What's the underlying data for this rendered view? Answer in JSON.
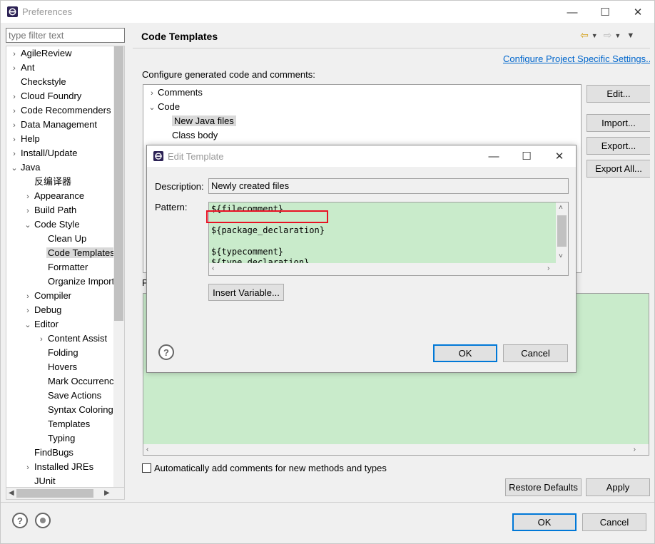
{
  "window": {
    "title": "Preferences",
    "controls": {
      "minimize": "—",
      "maximize": "☐",
      "close": "✕"
    }
  },
  "filter": {
    "placeholder": "type filter text"
  },
  "tree": [
    {
      "label": "AgileReview",
      "level": 0,
      "expand": "collapsed"
    },
    {
      "label": "Ant",
      "level": 0,
      "expand": "collapsed"
    },
    {
      "label": "Checkstyle",
      "level": 0,
      "expand": "none"
    },
    {
      "label": "Cloud Foundry",
      "level": 0,
      "expand": "collapsed"
    },
    {
      "label": "Code Recommenders",
      "level": 0,
      "expand": "collapsed"
    },
    {
      "label": "Data Management",
      "level": 0,
      "expand": "collapsed"
    },
    {
      "label": "Help",
      "level": 0,
      "expand": "collapsed"
    },
    {
      "label": "Install/Update",
      "level": 0,
      "expand": "collapsed"
    },
    {
      "label": "Java",
      "level": 0,
      "expand": "expanded"
    },
    {
      "label": "反编译器",
      "level": 1,
      "expand": "none"
    },
    {
      "label": "Appearance",
      "level": 1,
      "expand": "collapsed"
    },
    {
      "label": "Build Path",
      "level": 1,
      "expand": "collapsed"
    },
    {
      "label": "Code Style",
      "level": 1,
      "expand": "expanded"
    },
    {
      "label": "Clean Up",
      "level": 2,
      "expand": "none"
    },
    {
      "label": "Code Templates",
      "level": 2,
      "expand": "none",
      "selected": true
    },
    {
      "label": "Formatter",
      "level": 2,
      "expand": "none"
    },
    {
      "label": "Organize Imports",
      "level": 2,
      "expand": "none"
    },
    {
      "label": "Compiler",
      "level": 1,
      "expand": "collapsed"
    },
    {
      "label": "Debug",
      "level": 1,
      "expand": "collapsed"
    },
    {
      "label": "Editor",
      "level": 1,
      "expand": "expanded"
    },
    {
      "label": "Content Assist",
      "level": 2,
      "expand": "collapsed"
    },
    {
      "label": "Folding",
      "level": 2,
      "expand": "none"
    },
    {
      "label": "Hovers",
      "level": 2,
      "expand": "none"
    },
    {
      "label": "Mark Occurrences",
      "level": 2,
      "expand": "none"
    },
    {
      "label": "Save Actions",
      "level": 2,
      "expand": "none"
    },
    {
      "label": "Syntax Coloring",
      "level": 2,
      "expand": "none"
    },
    {
      "label": "Templates",
      "level": 2,
      "expand": "none"
    },
    {
      "label": "Typing",
      "level": 2,
      "expand": "none"
    },
    {
      "label": "FindBugs",
      "level": 1,
      "expand": "none"
    },
    {
      "label": "Installed JREs",
      "level": 1,
      "expand": "collapsed"
    },
    {
      "label": "JUnit",
      "level": 1,
      "expand": "none"
    }
  ],
  "page": {
    "title": "Code Templates",
    "configure_link": "Configure Project Specific Settings...",
    "configure_label": "Configure generated code and comments:",
    "pattern_label": "P",
    "auto_comments_label": "Automatically add comments for new methods and types",
    "template_tree": [
      {
        "label": "Comments",
        "level": 0,
        "expand": "collapsed"
      },
      {
        "label": "Code",
        "level": 0,
        "expand": "expanded"
      },
      {
        "label": "New Java files",
        "level": 1,
        "expand": "none",
        "selected": true
      },
      {
        "label": "Class body",
        "level": 1,
        "expand": "none"
      }
    ],
    "buttons": {
      "edit": "Edit...",
      "import": "Import...",
      "export": "Export...",
      "export_all": "Export All...",
      "restore_defaults": "Restore Defaults",
      "apply": "Apply",
      "ok": "OK",
      "cancel": "Cancel"
    }
  },
  "dialog": {
    "title": "Edit Template",
    "description_label": "Description:",
    "description_value": "Newly created files",
    "pattern_label": "Pattern:",
    "pattern_lines": [
      "${filecomment}",
      "",
      "${package_declaration}",
      "",
      "${typecomment}",
      "${type_declaration}"
    ],
    "insert_variable": "Insert Variable...",
    "ok": "OK",
    "cancel": "Cancel"
  },
  "colors": {
    "editor_bg": "#c9ebcb",
    "link": "#0066cc",
    "highlight_box": "#e81123",
    "default_button_border": "#0078d7"
  }
}
